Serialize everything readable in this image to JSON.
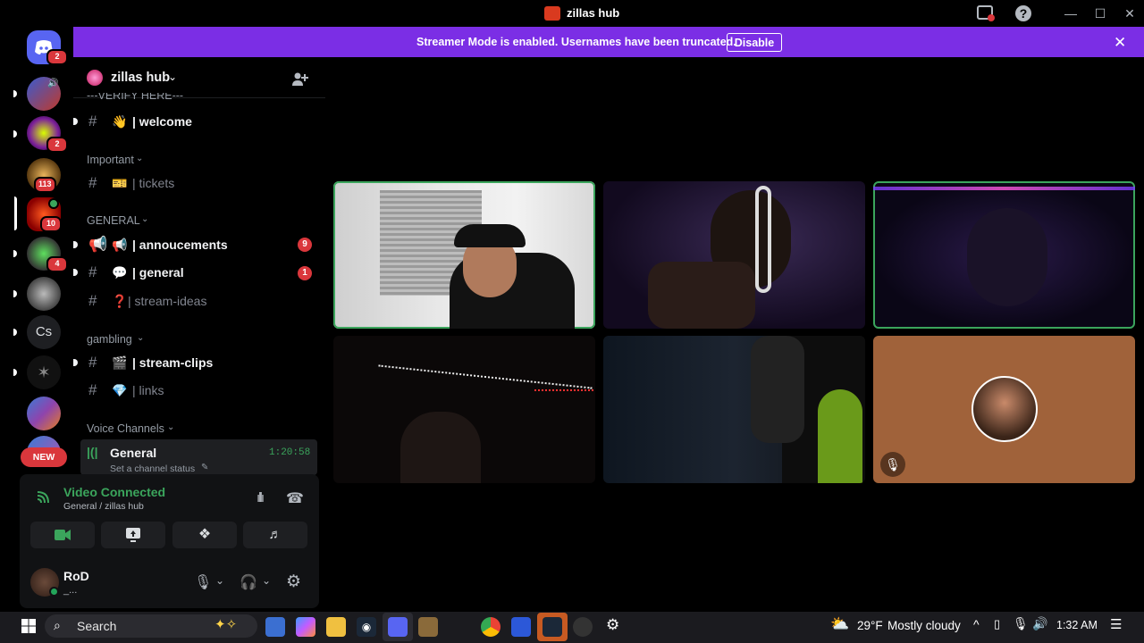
{
  "window": {
    "title": "zillas hub"
  },
  "banner": {
    "text": "Streamer Mode is enabled. Usernames have been truncated.",
    "button": "Disable"
  },
  "guilds": {
    "badges": [
      "2",
      "2",
      "113",
      "10",
      "4"
    ],
    "cs_label": "Cs",
    "new_label": "NEW"
  },
  "server": {
    "name": "zillas hub",
    "partial_category": "---VERIFY HERE---"
  },
  "channels": {
    "welcome": {
      "emoji": "👋",
      "name": "| welcome"
    },
    "important_cat": "Important",
    "tickets": {
      "emoji": "🎫",
      "name": "| tickets"
    },
    "general_cat": "GENERAL",
    "announcements": {
      "emoji": "📢",
      "name": "| annoucements",
      "mentions": "9"
    },
    "general": {
      "emoji": "💬",
      "name": "| general",
      "mentions": "1"
    },
    "ideas": {
      "emoji": "❓",
      "name": "| stream-ideas"
    },
    "gambling_cat": "gambling",
    "clips": {
      "emoji": "🎬",
      "name": "| stream-clips"
    },
    "links": {
      "emoji": "💎",
      "name": "| links"
    },
    "voice_cat": "Voice Channels",
    "voice_general": {
      "name": "General",
      "timer": "1:20:58",
      "status": "Set a channel status"
    }
  },
  "voice": {
    "status": "Video Connected",
    "location": "General / zillas hub"
  },
  "user": {
    "name": "RoD",
    "status": "_..."
  },
  "taskbar": {
    "search": "Search",
    "weather_temp": "29°F",
    "weather_desc": "Mostly cloudy",
    "time": "1:32 AM"
  },
  "colors": {
    "accent": "#7b2ee5",
    "connected": "#3ba55c",
    "mention": "#da373c"
  }
}
